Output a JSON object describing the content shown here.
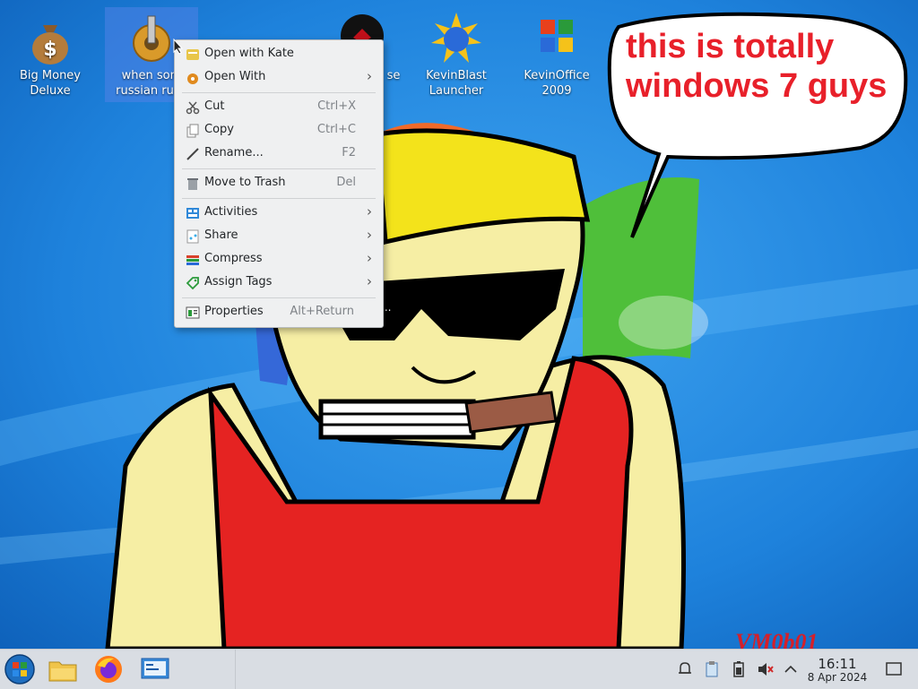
{
  "desktop": {
    "icons": [
      {
        "label_line1": "Big Money",
        "label_line2": "Deluxe",
        "icon": "money-bag-icon"
      },
      {
        "label_line1": "when som",
        "label_line2": "russian runs",
        "icon": "gear-icon"
      },
      {
        "label_line1": "se",
        "label_line2": "",
        "icon": "red-circle-icon"
      },
      {
        "label_line1": "KevinBlast",
        "label_line2": "Launcher",
        "icon": "kevinblast-icon"
      },
      {
        "label_line1": "KevinOffice",
        "label_line2": "2009",
        "icon": "office-icon"
      }
    ],
    "speech_bubble": {
      "line1": "this is totally",
      "line2": "windows 7 guys"
    },
    "signature": "VM0b01",
    "partial_text": "..."
  },
  "context_menu": {
    "items": [
      {
        "label": "Open with Kate",
        "icon": "kate-icon",
        "shortcut": "",
        "submenu": false
      },
      {
        "label": "Open With",
        "icon": "open-with-icon",
        "shortcut": "",
        "submenu": true
      },
      {
        "label": "Cut",
        "icon": "scissors-icon",
        "shortcut": "Ctrl+X",
        "submenu": false
      },
      {
        "label": "Copy",
        "icon": "copy-icon",
        "shortcut": "Ctrl+C",
        "submenu": false
      },
      {
        "label": "Rename...",
        "icon": "rename-icon",
        "shortcut": "F2",
        "submenu": false
      },
      {
        "label": "Move to Trash",
        "icon": "trash-icon",
        "shortcut": "Del",
        "submenu": false
      },
      {
        "label": "Activities",
        "icon": "activities-icon",
        "shortcut": "",
        "submenu": true
      },
      {
        "label": "Share",
        "icon": "share-icon",
        "shortcut": "",
        "submenu": true
      },
      {
        "label": "Compress",
        "icon": "compress-icon",
        "shortcut": "",
        "submenu": true
      },
      {
        "label": "Assign Tags",
        "icon": "tag-icon",
        "shortcut": "",
        "submenu": true
      },
      {
        "label": "Properties",
        "icon": "properties-icon",
        "shortcut": "Alt+Return",
        "submenu": false
      }
    ]
  },
  "taskbar": {
    "apps": [
      "start-orb-icon",
      "file-manager-icon",
      "firefox-icon",
      "system-settings-icon"
    ],
    "tray": [
      "notifications-icon",
      "clipboard-icon",
      "battery-icon",
      "volume-muted-icon",
      "chevron-up-icon"
    ],
    "clock": {
      "time": "16:11",
      "date": "8 Apr 2024"
    }
  },
  "colors": {
    "accent": "#3daee9",
    "bubble_text": "#e8202a",
    "taskbar": "#d9dde3"
  }
}
